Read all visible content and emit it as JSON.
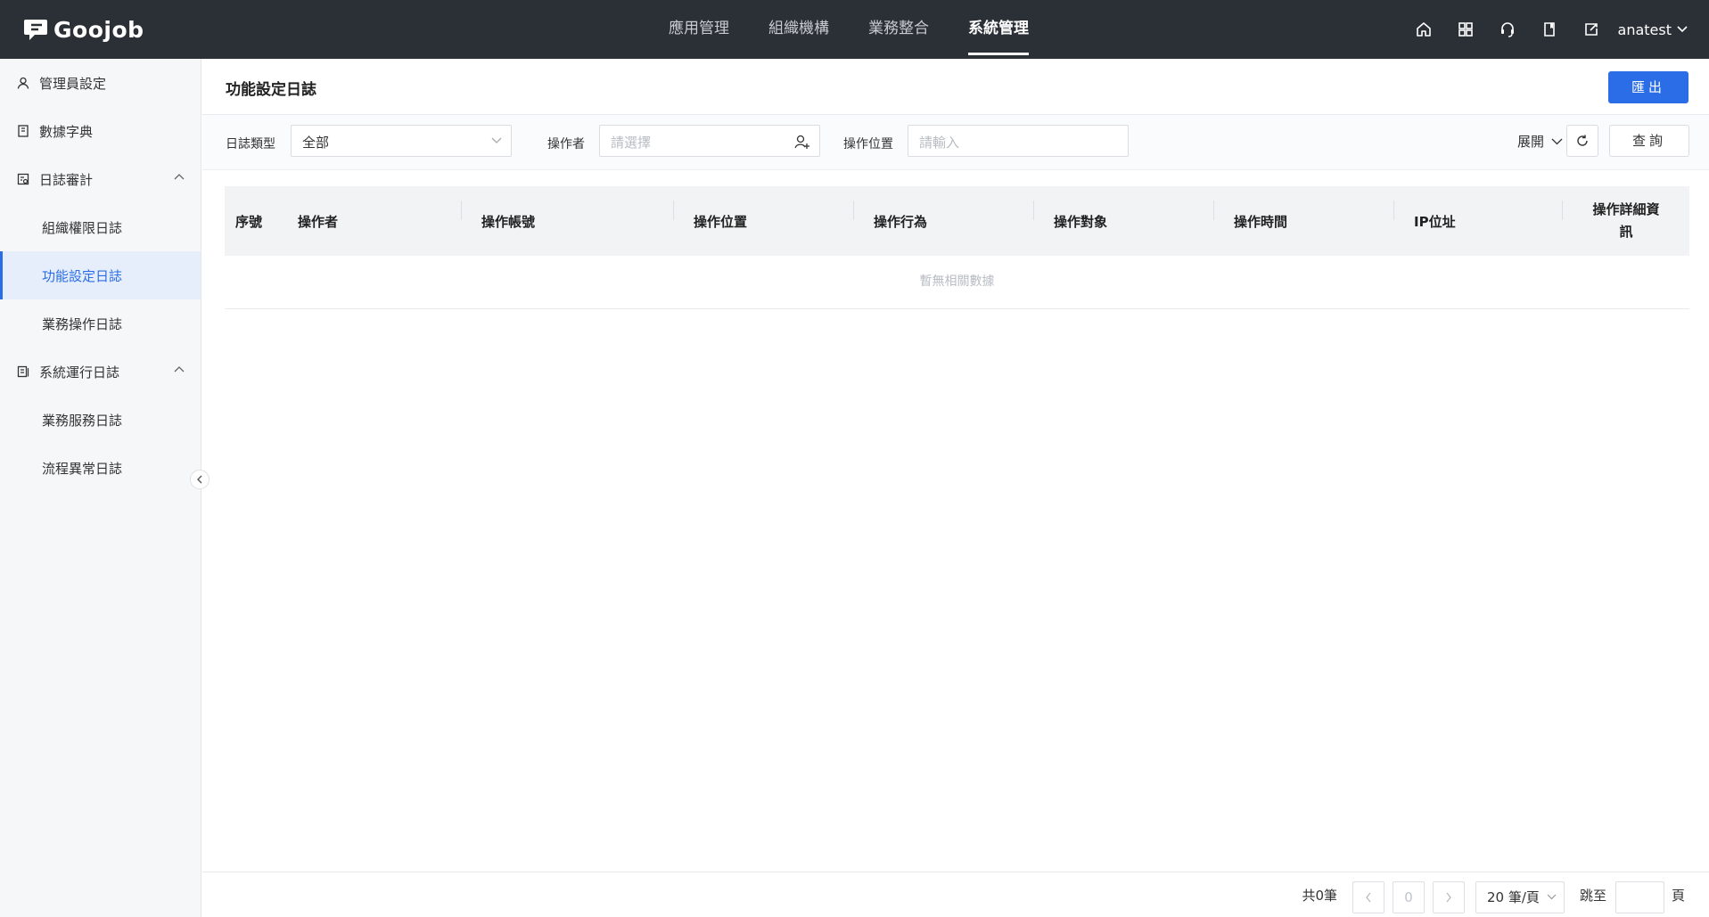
{
  "app": {
    "logo_text": "Goojob"
  },
  "topnav": [
    {
      "label": "應用管理"
    },
    {
      "label": "組織機構"
    },
    {
      "label": "業務整合"
    },
    {
      "label": "系統管理"
    }
  ],
  "user": {
    "name": "anatest"
  },
  "icons": [
    "home-icon",
    "apps-grid-icon",
    "headset-icon",
    "book-icon",
    "edit-export-icon"
  ],
  "sidebar": {
    "items": [
      {
        "label": "管理員設定",
        "icon": "user-icon"
      },
      {
        "label": "數據字典",
        "icon": "book-icon"
      },
      {
        "label": "日誌審計",
        "icon": "audit-icon",
        "expanded": true
      },
      {
        "label": "組織權限日誌"
      },
      {
        "label": "功能設定日誌",
        "active": true
      },
      {
        "label": "業務操作日誌"
      },
      {
        "label": "系統運行日誌",
        "icon": "log-icon",
        "expanded": true
      },
      {
        "label": "業務服務日誌"
      },
      {
        "label": "流程異常日誌"
      }
    ]
  },
  "page": {
    "title": "功能設定日誌",
    "export_label": "匯出"
  },
  "filters": {
    "log_type_label": "日誌類型",
    "log_type_value": "全部",
    "operator_label": "操作者",
    "operator_placeholder": "請選擇",
    "location_label": "操作位置",
    "location_placeholder": "請輸入",
    "expand_label": "展開",
    "query_label": "查詢"
  },
  "table": {
    "columns": [
      "序號",
      "操作者",
      "操作帳號",
      "操作位置",
      "操作行為",
      "操作對象",
      "操作時間",
      "IP位址",
      "操作詳細資訊"
    ],
    "detail_col_line1": "操作詳細資",
    "detail_col_line2": "訊",
    "empty_text": "暫無相關數據",
    "rows": []
  },
  "pagination": {
    "total_label": "共0筆",
    "current_page": "0",
    "page_size_label": "20 筆/頁",
    "jump_label": "跳至",
    "page_label": "頁"
  },
  "colors": {
    "accent": "#2a6de6",
    "topbar": "#2b2f36"
  }
}
